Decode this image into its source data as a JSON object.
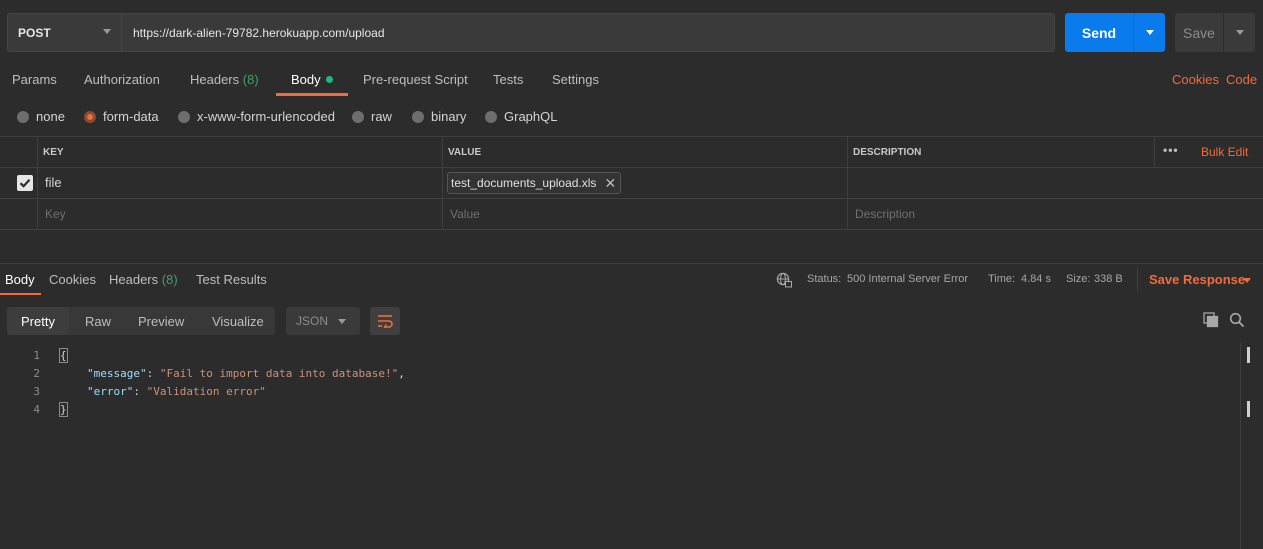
{
  "request": {
    "method": "POST",
    "url": "https://dark-alien-79782.herokuapp.com/upload",
    "send_label": "Send",
    "save_label": "Save"
  },
  "request_tabs": [
    {
      "label": "Params"
    },
    {
      "label": "Authorization"
    },
    {
      "label": "Headers",
      "count": "(8)"
    },
    {
      "label": "Body"
    },
    {
      "label": "Pre-request Script"
    },
    {
      "label": "Tests"
    },
    {
      "label": "Settings"
    }
  ],
  "links": {
    "cookies": "Cookies",
    "code": "Code"
  },
  "body_modes": [
    "none",
    "form-data",
    "x-www-form-urlencoded",
    "raw",
    "binary",
    "GraphQL"
  ],
  "table": {
    "headers": {
      "key": "KEY",
      "value": "VALUE",
      "description": "DESCRIPTION",
      "bulk_edit": "Bulk Edit",
      "more": "•••"
    },
    "rows": [
      {
        "key": "file",
        "value": "test_documents_upload.xls"
      }
    ],
    "placeholders": {
      "key": "Key",
      "value": "Value",
      "description": "Description"
    }
  },
  "response_tabs": [
    {
      "label": "Body"
    },
    {
      "label": "Cookies"
    },
    {
      "label": "Headers",
      "count": "(8)"
    },
    {
      "label": "Test Results"
    }
  ],
  "response_meta": {
    "status_label": "Status:",
    "status_value": "500 Internal Server Error",
    "time_label": "Time:",
    "time_value": "4.84 s",
    "size_label": "Size:",
    "size_value": "338 B",
    "save_response": "Save Response"
  },
  "view_modes": [
    "Pretty",
    "Raw",
    "Preview",
    "Visualize"
  ],
  "format": "JSON",
  "code": {
    "line_numbers": [
      "1",
      "2",
      "3",
      "4"
    ],
    "open_brace": "{",
    "close_brace": "}",
    "message_key": "\"message\"",
    "message_value": "\"Fail to import data into database!\"",
    "error_key": "\"error\"",
    "error_value": "\"Validation error\""
  },
  "colors": {
    "accent": "#f26b3a",
    "send": "#097bed",
    "status_ok": "#3fa15f"
  }
}
